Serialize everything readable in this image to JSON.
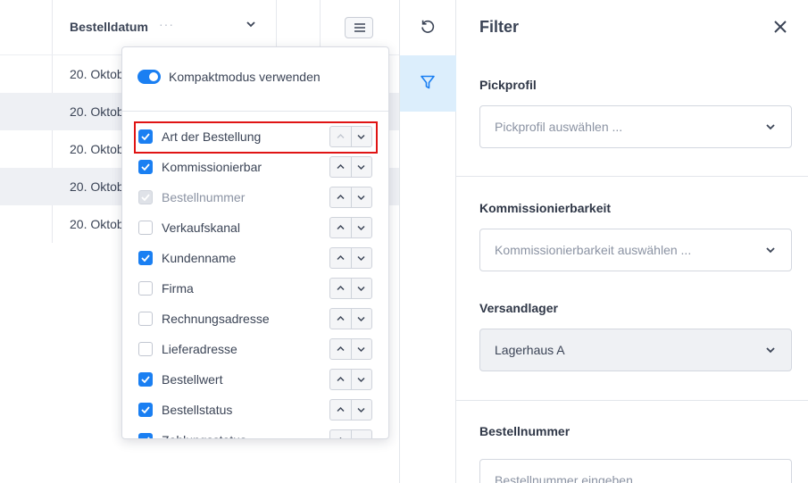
{
  "table": {
    "column_header": "Bestelldatum",
    "header_dots": "···",
    "rows": [
      "20. Oktob",
      "20. Oktob",
      "20. Oktob",
      "20. Oktob",
      "20. Oktob"
    ]
  },
  "column_menu": {
    "compact_mode_label": "Kompaktmodus verwenden",
    "compact_mode_enabled": true,
    "columns": [
      {
        "label": "Art der Bestellung",
        "checked": true
      },
      {
        "label": "Kommissionierbar",
        "checked": true
      },
      {
        "label": "Bestellnummer",
        "checked": true,
        "disabled": true
      },
      {
        "label": "Verkaufskanal",
        "checked": false
      },
      {
        "label": "Kundenname",
        "checked": true
      },
      {
        "label": "Firma",
        "checked": false
      },
      {
        "label": "Rechnungsadresse",
        "checked": false
      },
      {
        "label": "Lieferadresse",
        "checked": false
      },
      {
        "label": "Bestellwert",
        "checked": true
      },
      {
        "label": "Bestellstatus",
        "checked": true
      },
      {
        "label": "Zahlungsstatus",
        "checked": true
      }
    ]
  },
  "filter": {
    "title": "Filter",
    "pickprofil": {
      "label": "Pickprofil",
      "placeholder": "Pickprofil auswählen ..."
    },
    "kommissionierbarkeit": {
      "label": "Kommissionierbarkeit",
      "placeholder": "Kommissionierbarkeit auswählen ..."
    },
    "versandlager": {
      "label": "Versandlager",
      "value": "Lagerhaus A"
    },
    "bestellnummer": {
      "label": "Bestellnummer",
      "placeholder": "Bestellnummer eingeben ..."
    }
  },
  "colors": {
    "accent": "#1a7ff2",
    "highlight": "#e01414",
    "active_tool_bg": "#dceefc"
  },
  "icons": {
    "menu": "hamburger-icon",
    "reset": "reset-icon",
    "filter": "filter-icon",
    "close": "close-icon"
  }
}
